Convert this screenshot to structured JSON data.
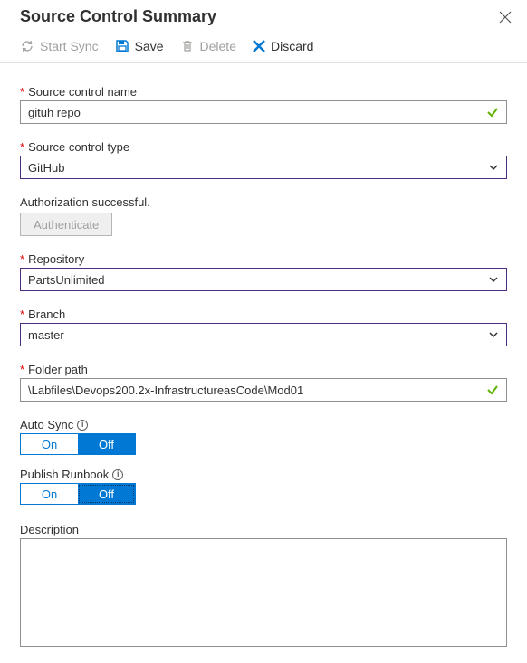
{
  "header": {
    "title": "Source Control Summary"
  },
  "toolbar": {
    "sync": "Start Sync",
    "save": "Save",
    "delete": "Delete",
    "discard": "Discard"
  },
  "labels": {
    "sourceControlName": "Source control name",
    "sourceControlType": "Source control type",
    "authStatus": "Authorization successful.",
    "authButton": "Authenticate",
    "repository": "Repository",
    "branch": "Branch",
    "folderPath": "Folder path",
    "autoSync": "Auto Sync",
    "publishRunbook": "Publish Runbook",
    "description": "Description",
    "on": "On",
    "off": "Off"
  },
  "values": {
    "sourceControlName": "gituh repo",
    "sourceControlType": "GitHub",
    "repository": "PartsUnlimited",
    "branch": "master",
    "folderPath": "\\Labfiles\\Devops200.2x-InfrastructureasCode\\Mod01"
  }
}
